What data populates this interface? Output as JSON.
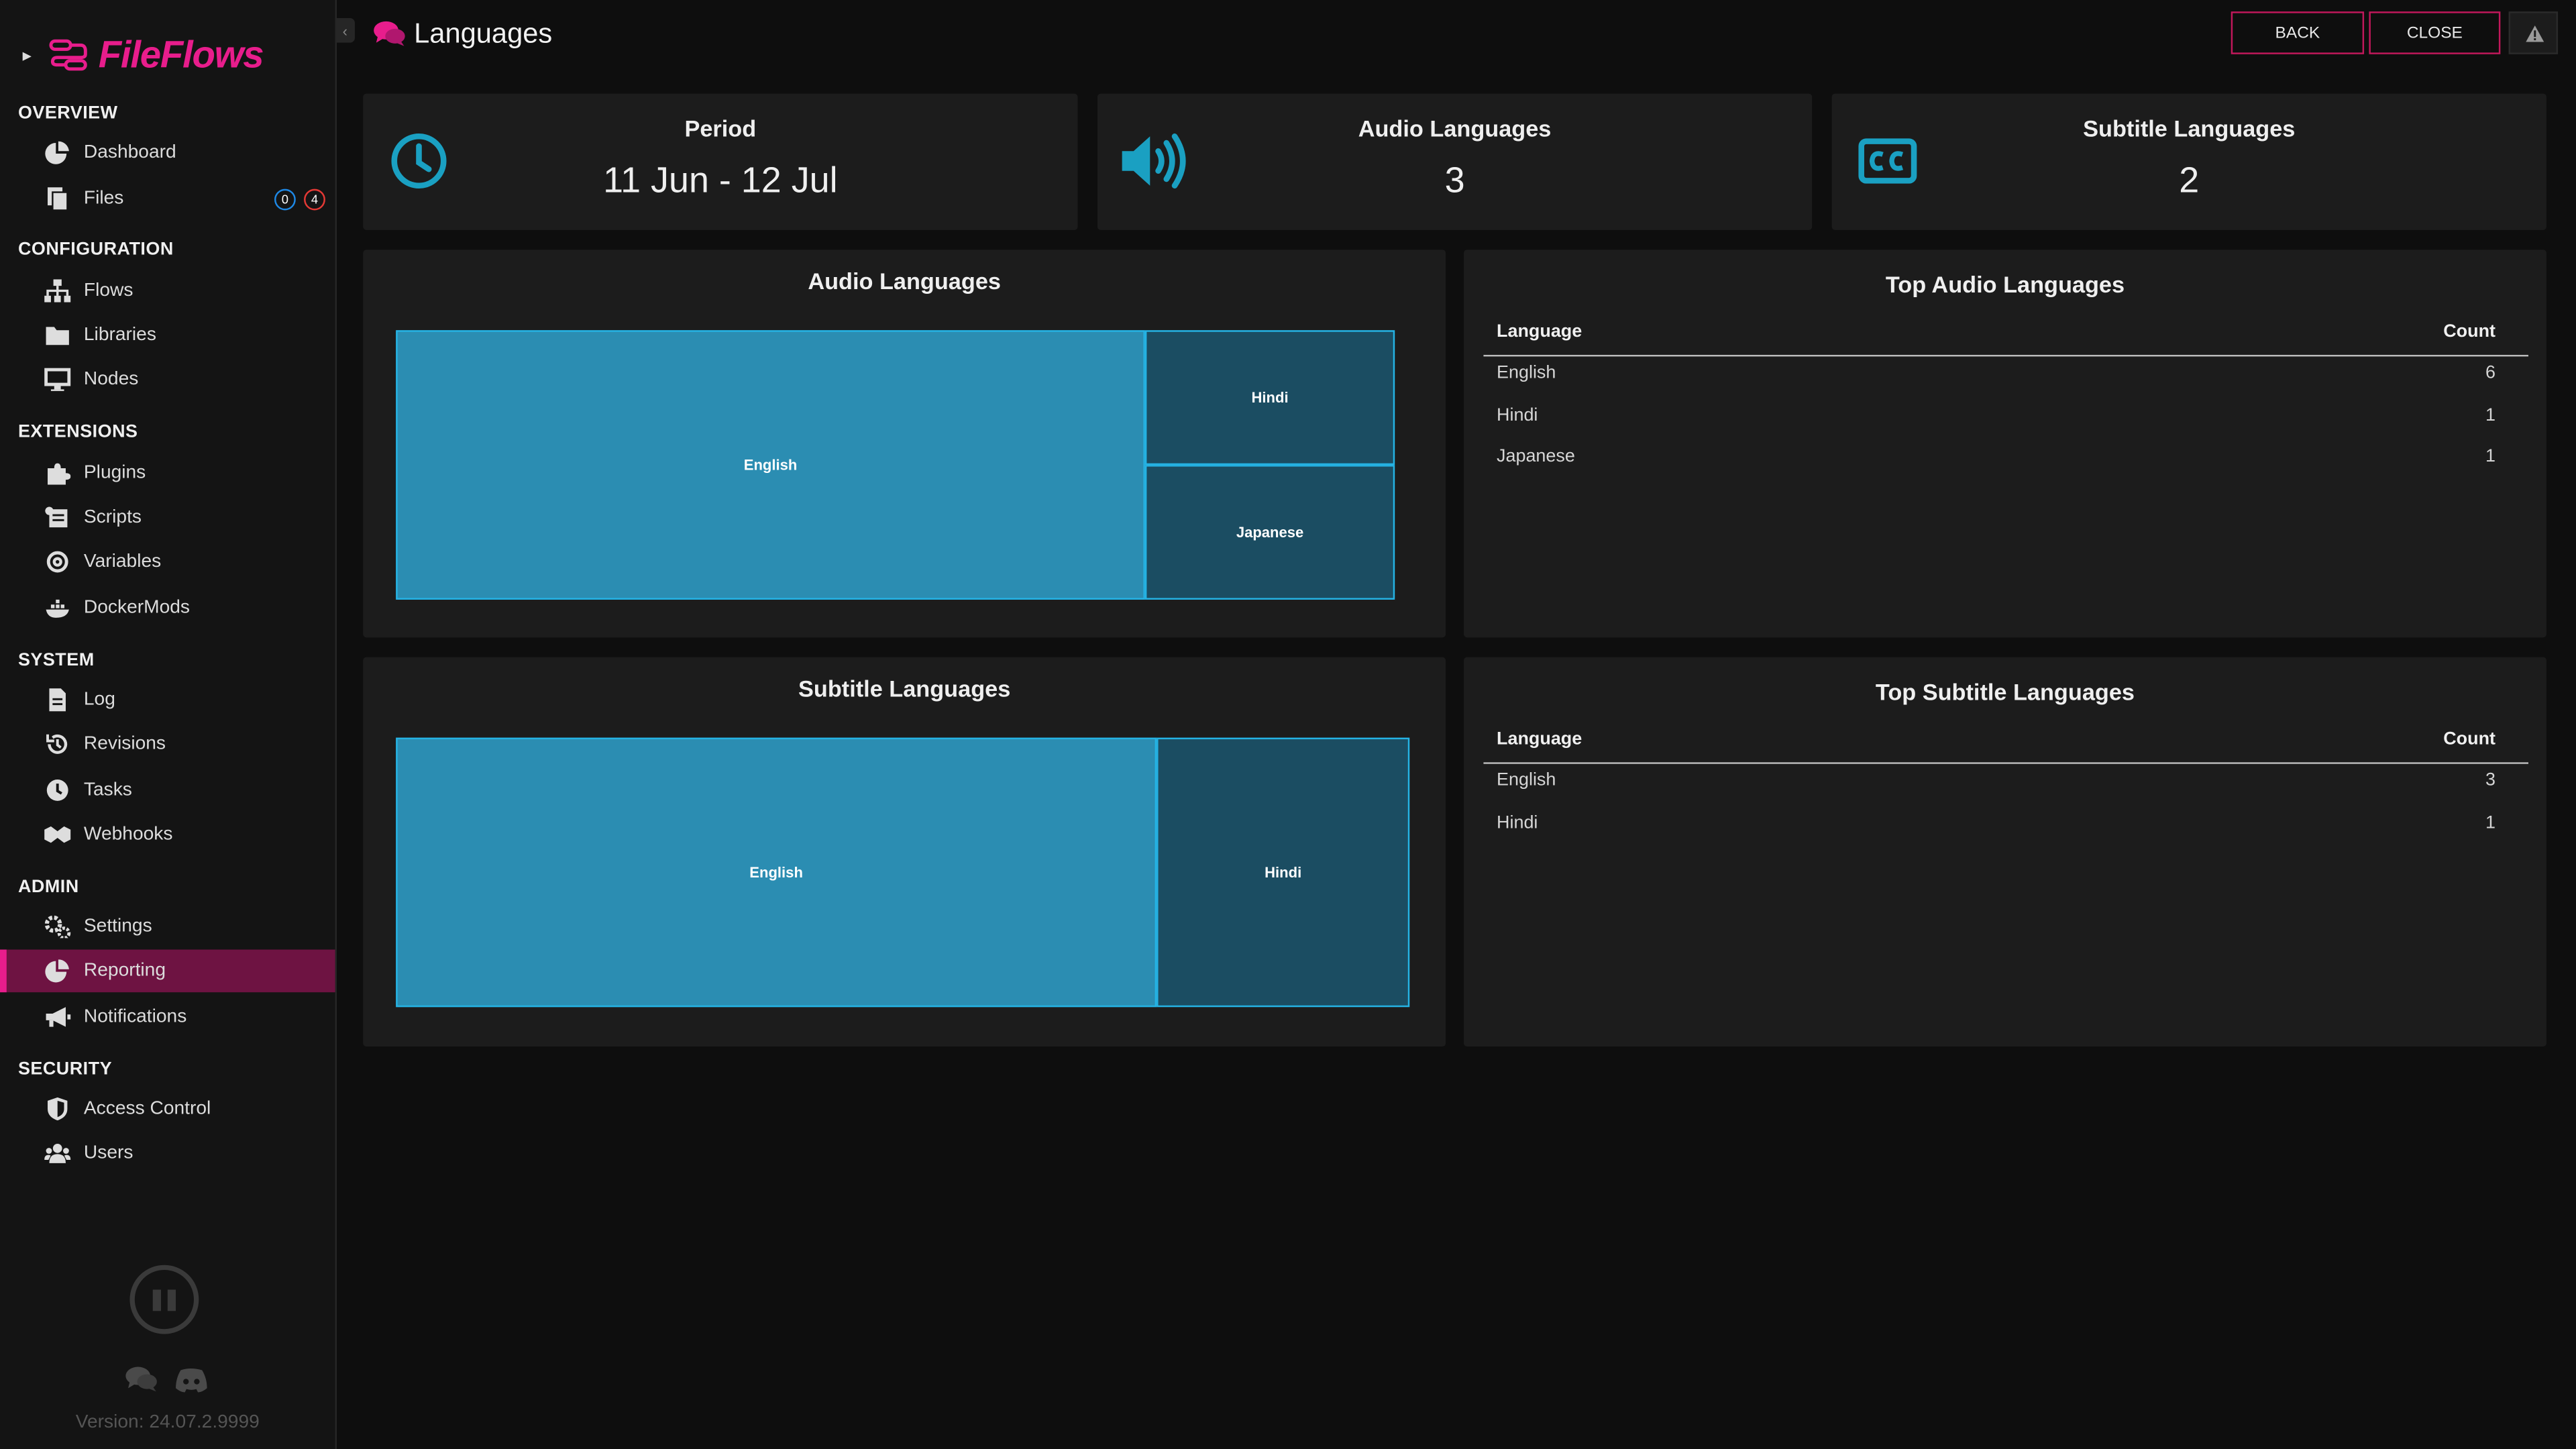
{
  "app": {
    "name": "FileFlows",
    "version": "Version: 24.07.2.9999"
  },
  "sidebar": {
    "sections": [
      {
        "title": "OVERVIEW",
        "items": [
          {
            "label": "Dashboard",
            "icon": "pie-chart-icon"
          },
          {
            "label": "Files",
            "icon": "files-icon",
            "badges": [
              "0",
              "4"
            ]
          }
        ]
      },
      {
        "title": "CONFIGURATION",
        "items": [
          {
            "label": "Flows",
            "icon": "sitemap-icon"
          },
          {
            "label": "Libraries",
            "icon": "folder-icon"
          },
          {
            "label": "Nodes",
            "icon": "desktop-icon"
          }
        ]
      },
      {
        "title": "EXTENSIONS",
        "items": [
          {
            "label": "Plugins",
            "icon": "puzzle-icon"
          },
          {
            "label": "Scripts",
            "icon": "scroll-icon"
          },
          {
            "label": "Variables",
            "icon": "at-icon"
          },
          {
            "label": "DockerMods",
            "icon": "docker-icon"
          }
        ]
      },
      {
        "title": "SYSTEM",
        "items": [
          {
            "label": "Log",
            "icon": "file-text-icon"
          },
          {
            "label": "Revisions",
            "icon": "history-icon"
          },
          {
            "label": "Tasks",
            "icon": "clock-icon"
          },
          {
            "label": "Webhooks",
            "icon": "handshake-icon"
          }
        ]
      },
      {
        "title": "ADMIN",
        "items": [
          {
            "label": "Settings",
            "icon": "gears-icon"
          },
          {
            "label": "Reporting",
            "icon": "pie-chart-icon",
            "active": true
          },
          {
            "label": "Notifications",
            "icon": "bullhorn-icon"
          }
        ]
      },
      {
        "title": "SECURITY",
        "items": [
          {
            "label": "Access Control",
            "icon": "shield-icon"
          },
          {
            "label": "Users",
            "icon": "users-icon"
          }
        ]
      }
    ]
  },
  "header": {
    "title": "Languages",
    "back": "BACK",
    "close": "CLOSE"
  },
  "stats": {
    "period": {
      "label": "Period",
      "value": "11 Jun - 12 Jul"
    },
    "audio": {
      "label": "Audio Languages",
      "value": "3"
    },
    "subtitle": {
      "label": "Subtitle Languages",
      "value": "2"
    }
  },
  "charts": {
    "audio_title": "Audio Languages",
    "subtitle_title": "Subtitle Languages"
  },
  "chart_data": [
    {
      "type": "treemap",
      "title": "Audio Languages",
      "categories": [
        "English",
        "Hindi",
        "Japanese"
      ],
      "values": [
        6,
        1,
        1
      ]
    },
    {
      "type": "treemap",
      "title": "Subtitle Languages",
      "categories": [
        "English",
        "Hindi"
      ],
      "values": [
        3,
        1
      ]
    }
  ],
  "tables": {
    "audio": {
      "title": "Top Audio Languages",
      "columns": [
        "Language",
        "Count"
      ],
      "rows": [
        [
          "English",
          "6"
        ],
        [
          "Hindi",
          "1"
        ],
        [
          "Japanese",
          "1"
        ]
      ]
    },
    "subtitle": {
      "title": "Top Subtitle Languages",
      "columns": [
        "Language",
        "Count"
      ],
      "rows": [
        [
          "English",
          "3"
        ],
        [
          "Hindi",
          "1"
        ]
      ]
    }
  },
  "colors": {
    "accent": "#e81d8c",
    "active_bg": "#6e1342",
    "treemap_primary": "#2b8db2",
    "treemap_secondary": "#1b4d62",
    "stat_icon": "#1aa0c2",
    "badge_blue": "#1e88e5",
    "badge_red": "#e53935"
  }
}
